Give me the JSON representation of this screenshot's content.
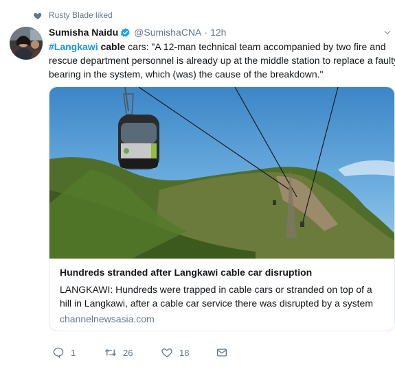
{
  "social_context": {
    "icon": "heart-icon",
    "text": "Rusty Blade liked"
  },
  "tweet": {
    "author_name": "Sumisha Naidu",
    "handle": "@SumishaCNA",
    "separator": "·",
    "time": "12h",
    "text_line1_hashtag": "#Langkawi",
    "text_line1_strong": "cable",
    "text_line1_rest": " cars: \"A 12-man technical team accompanied by two fire and",
    "text_line2": "rescue department personnel is already up at the middle station to replace a faulty",
    "text_line3": "bearing in the system, which (was) the cause of the breakdown.\""
  },
  "card": {
    "title": "Hundreds stranded after Langkawi cable car disruption",
    "description": "LANGKAWI: Hundreds were trapped in cable cars or stranded on top of a hill in Langkawi, after a cable car service there was disrupted by a system",
    "domain": "channelnewsasia.com"
  },
  "actions": {
    "reply_count": "1",
    "retweet_count": "26",
    "like_count": "18"
  },
  "colors": {
    "link": "#1b95e0",
    "muted": "#657786",
    "text": "#14171a",
    "border": "#e1e8ed"
  }
}
